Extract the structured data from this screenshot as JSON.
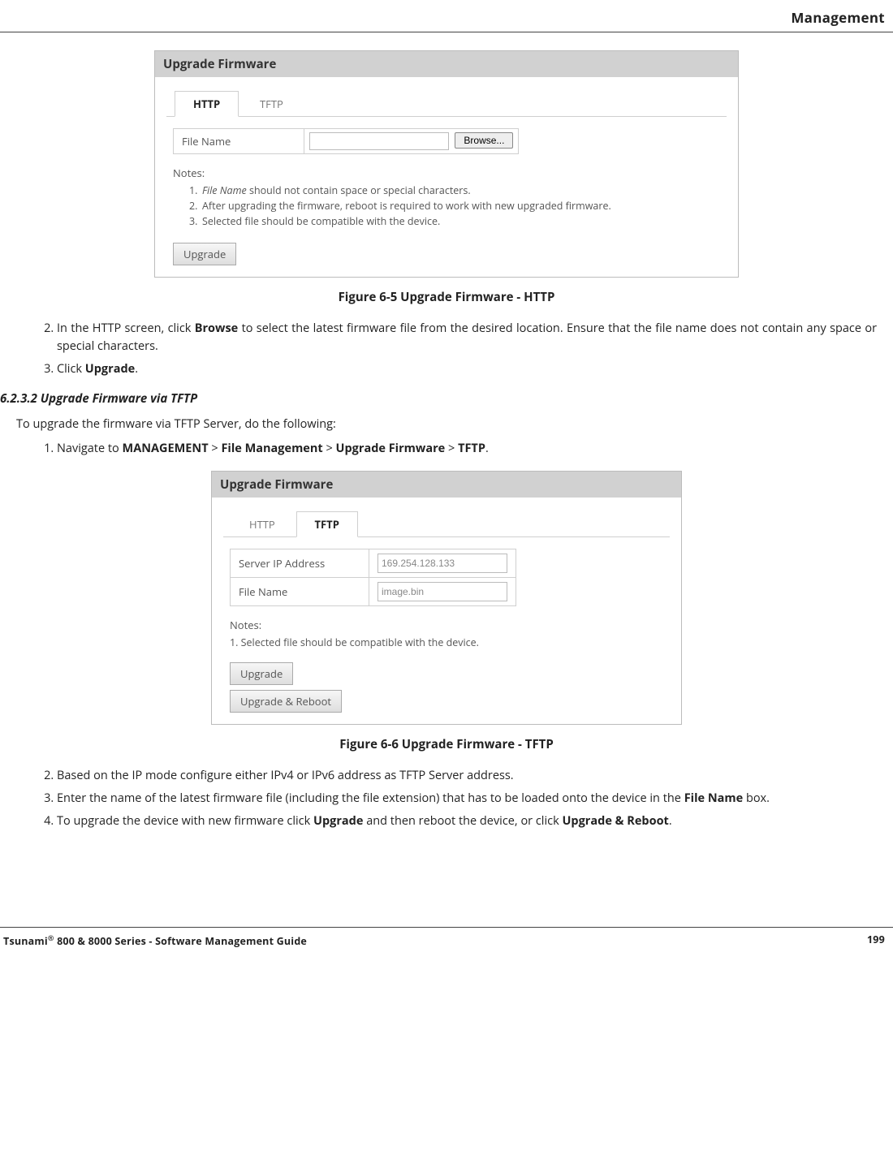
{
  "header": {
    "title": "Management"
  },
  "figure1": {
    "panel_title": "Upgrade Firmware",
    "tabs": {
      "http": "HTTP",
      "tftp": "TFTP"
    },
    "file_name_label": "File Name",
    "browse_btn": "Browse...",
    "notes_label": "Notes:",
    "notes": [
      {
        "num": "1.",
        "prefix_em": "File Name",
        "rest": " should not contain space or special characters."
      },
      {
        "num": "2.",
        "prefix_em": "",
        "rest": "After upgrading the firmware, reboot is required to work with new upgraded firmware."
      },
      {
        "num": "3.",
        "prefix_em": "",
        "rest": "Selected file should be compatible with the device."
      }
    ],
    "upgrade_btn": "Upgrade",
    "caption": "Figure 6-5 Upgrade Firmware - HTTP"
  },
  "steps1": {
    "start": 2,
    "items": [
      {
        "pre": "In the HTTP screen, click ",
        "b": "Browse",
        "post": " to select the latest firmware file from the desired location. Ensure that the file name does not contain any space or special characters."
      },
      {
        "pre": "Click ",
        "b": "Upgrade",
        "post": "."
      }
    ]
  },
  "section_h": "6.2.3.2 Upgrade Firmware via TFTP",
  "intro": "To upgrade the firmware via TFTP Server, do the following:",
  "steps2a": {
    "start": 1,
    "text_pre": "Navigate to ",
    "path": [
      "MANAGEMENT",
      "File Management",
      "Upgrade Firmware",
      "TFTP"
    ]
  },
  "figure2": {
    "panel_title": "Upgrade Firmware",
    "tabs": {
      "http": "HTTP",
      "tftp": "TFTP"
    },
    "server_ip_label": "Server IP Address",
    "server_ip_value": "169.254.128.133",
    "file_name_label": "File Name",
    "file_name_value": "image.bin",
    "notes_label": "Notes:",
    "note1": "1. Selected file should be compatible with the device.",
    "upgrade_btn": "Upgrade",
    "upgrade_reboot_btn": "Upgrade & Reboot",
    "caption": "Figure 6-6 Upgrade Firmware - TFTP"
  },
  "steps2b": {
    "start": 2,
    "items": [
      {
        "html": "Based on the IP mode configure either IPv4 or IPv6 address as TFTP Server address."
      },
      {
        "html": "Enter the name of the latest firmware file (including the file extension) that has to be loaded onto the device in the <span class=\"b\">File Name</span> box."
      },
      {
        "html": "To upgrade the device with new firmware click <span class=\"b\">Upgrade</span> and then reboot the device, or click <span class=\"b\">Upgrade & Reboot</span>."
      }
    ]
  },
  "footer": {
    "left_pre": "Tsunami",
    "left_sup": "®",
    "left_post": " 800 & 8000 Series - Software Management Guide",
    "page": "199"
  }
}
